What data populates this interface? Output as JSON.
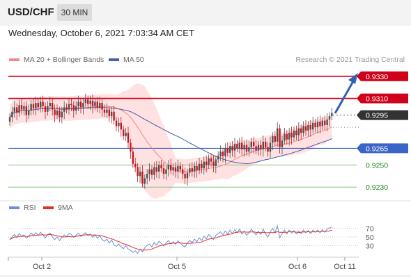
{
  "header": {
    "symbol": "USD/CHF",
    "timeframe": "30 MIN"
  },
  "datetime": "Wednesday, October 6, 2021 7:03:34 AM CET",
  "legend": {
    "bb_label": "MA 20 + Bollinger Bands",
    "ma50_label": "MA 50",
    "copyright": "Research © 2021 Trading Central"
  },
  "rsi_legend": {
    "rsi_label": "RSI",
    "ma9_label": "9MA"
  },
  "colors": {
    "up_candle": "#4f4f4f",
    "down_candle": "#c9141e",
    "resistance": "#d0021b",
    "support": "#3a64c8",
    "target": "#7fbf7f",
    "bollinger_fill": "#ffd7d7",
    "ma20": "#f08a8a",
    "ma50": "#4a5ea8",
    "rsi": "#6d8ed8",
    "rsi_ma": "#e0301e",
    "arrow": "#2f62b0"
  },
  "chart_data": [
    {
      "type": "candlestick",
      "title": "USD/CHF 30 MIN",
      "x_ticks": [
        "Oct 2",
        "Oct 5",
        "Oct 6",
        "Oct 11"
      ],
      "ylim": [
        0.9222,
        0.9338
      ],
      "levels": [
        {
          "value": 0.933,
          "label": "0.9330",
          "kind": "resistance"
        },
        {
          "value": 0.931,
          "label": "0.9310",
          "kind": "resistance"
        },
        {
          "value": 0.9295,
          "label": "0.9295",
          "kind": "last_price"
        },
        {
          "value": 0.9265,
          "label": "0.9265",
          "kind": "pivot"
        },
        {
          "value": 0.925,
          "label": "0.9250",
          "kind": "target"
        },
        {
          "value": 0.923,
          "label": "0.9230",
          "kind": "target"
        }
      ],
      "close": [
        0.9293,
        0.9298,
        0.9302,
        0.9297,
        0.9304,
        0.93,
        0.9303,
        0.9295,
        0.9299,
        0.9305,
        0.9301,
        0.9306,
        0.9302,
        0.9307,
        0.9303,
        0.9298,
        0.9303,
        0.9306,
        0.93,
        0.9295,
        0.9299,
        0.9293,
        0.9298,
        0.9302,
        0.93,
        0.9305,
        0.9304,
        0.9299,
        0.9303,
        0.9307,
        0.9302,
        0.9306,
        0.9309,
        0.9305,
        0.9308,
        0.9303,
        0.9307,
        0.9302,
        0.9306,
        0.93,
        0.9297,
        0.93,
        0.9294,
        0.9298,
        0.929,
        0.9285,
        0.9288,
        0.9282,
        0.9276,
        0.9279,
        0.927,
        0.9262,
        0.9251,
        0.9248,
        0.924,
        0.9244,
        0.9233,
        0.9238,
        0.9242,
        0.9246,
        0.9241,
        0.9248,
        0.9244,
        0.925,
        0.9247,
        0.9242,
        0.9246,
        0.925,
        0.9245,
        0.9248,
        0.9244,
        0.9249,
        0.9246,
        0.9242,
        0.9238,
        0.9243,
        0.9247,
        0.9244,
        0.9249,
        0.9245,
        0.9251,
        0.9247,
        0.9253,
        0.925,
        0.9256,
        0.9253,
        0.9249,
        0.9255,
        0.9258,
        0.9262,
        0.9258,
        0.9265,
        0.9261,
        0.9267,
        0.9263,
        0.9269,
        0.9265,
        0.927,
        0.9264,
        0.9268,
        0.9262,
        0.9266,
        0.9271,
        0.9267,
        0.9263,
        0.9268,
        0.9264,
        0.9271,
        0.9266,
        0.9262,
        0.927,
        0.9276,
        0.9271,
        0.9283,
        0.9266,
        0.9272,
        0.9278,
        0.9273,
        0.9279,
        0.9275,
        0.9281,
        0.9277,
        0.9283,
        0.9279,
        0.9285,
        0.9281,
        0.9286,
        0.9282,
        0.9288,
        0.9284,
        0.9289,
        0.9285,
        0.929,
        0.9286,
        0.9291,
        0.9294,
        0.9297
      ]
    },
    {
      "type": "line",
      "title": "RSI",
      "series": [
        {
          "name": "RSI"
        },
        {
          "name": "9MA"
        }
      ],
      "ylim": [
        0,
        100
      ],
      "yticks": [
        30,
        50,
        70
      ],
      "rsi": [
        44,
        50,
        56,
        49,
        58,
        52,
        55,
        47,
        52,
        59,
        53,
        60,
        54,
        61,
        55,
        48,
        55,
        59,
        50,
        44,
        50,
        42,
        49,
        55,
        51,
        58,
        56,
        49,
        54,
        59,
        51,
        56,
        60,
        53,
        57,
        49,
        55,
        47,
        53,
        44,
        40,
        45,
        36,
        43,
        32,
        28,
        34,
        27,
        23,
        30,
        22,
        19,
        14,
        18,
        12,
        22,
        15,
        25,
        30,
        34,
        27,
        37,
        31,
        40,
        35,
        29,
        36,
        42,
        34,
        39,
        33,
        41,
        36,
        30,
        27,
        36,
        42,
        37,
        45,
        39,
        48,
        42,
        52,
        46,
        56,
        50,
        44,
        54,
        58,
        62,
        55,
        64,
        57,
        66,
        58,
        67,
        60,
        68,
        57,
        63,
        54,
        60,
        68,
        61,
        55,
        63,
        56,
        68,
        57,
        50,
        62,
        70,
        60,
        76,
        48,
        58,
        66,
        57,
        66,
        59,
        65,
        57,
        64,
        58,
        66,
        60,
        65,
        58,
        66,
        61,
        66,
        60,
        67,
        61,
        68,
        71,
        73
      ]
    }
  ]
}
